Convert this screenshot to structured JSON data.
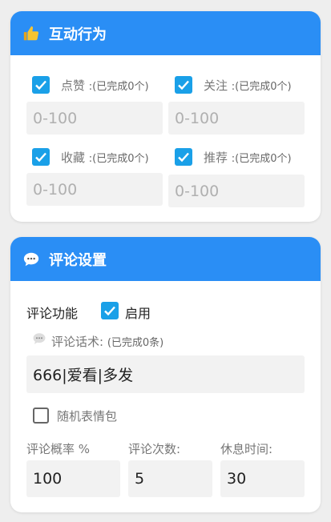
{
  "interaction_card": {
    "title": "互动行为",
    "icon": "thumbs-up-icon",
    "items": [
      {
        "label": "点赞",
        "status": ":(已完成0个)",
        "checked": true,
        "placeholder": "0-100"
      },
      {
        "label": "关注",
        "status": ":(已完成0个)",
        "checked": true,
        "placeholder": "0-100"
      },
      {
        "label": "收藏",
        "status": ":(已完成0个)",
        "checked": true,
        "placeholder": "0-100"
      },
      {
        "label": "推荐",
        "status": ":(已完成0个)",
        "checked": true,
        "placeholder": "0-100"
      }
    ]
  },
  "comment_card": {
    "title": "评论设置",
    "icon": "speech-bubble-icon",
    "function_label": "评论功能",
    "enable_label": "启用",
    "enable_checked": true,
    "script_label": "评论话术:",
    "script_status": "(已完成0条)",
    "script_value": "666|爱看|多发",
    "random_emoji_label": "随机表情包",
    "random_emoji_checked": false,
    "probability_label": "评论概率 %",
    "probability_value": "100",
    "count_label": "评论次数:",
    "count_value": "5",
    "rest_label": "休息时间:",
    "rest_value": "30"
  },
  "colors": {
    "header": "#2a8ef5",
    "checkbox": "#1aa0e8",
    "card": "#ffffff",
    "background": "#eeeeee"
  }
}
